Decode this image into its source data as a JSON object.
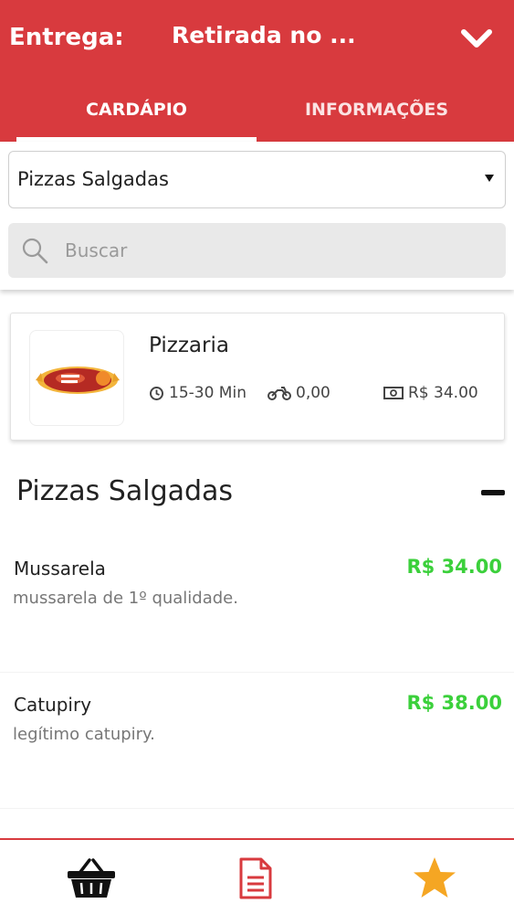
{
  "header": {
    "delivery_label": "Entrega:",
    "delivery_value": "Retirada no ...",
    "background_color": "#d83a3e",
    "tabs": [
      {
        "label": "CARDÁPIO",
        "active": true
      },
      {
        "label": "INFORMAÇÕES",
        "active": false
      }
    ]
  },
  "filter": {
    "category_selected": "Pizzas Salgadas",
    "search_placeholder": "Buscar"
  },
  "store": {
    "name": "Pizzaria",
    "time": "15-30 Min",
    "delivery_fee": "0,00",
    "min_order": "R$ 34.00"
  },
  "section": {
    "title": "Pizzas Salgadas"
  },
  "products": [
    {
      "name": "Mussarela",
      "description": "mussarela de 1º qualidade.",
      "price": "R$ 34.00"
    },
    {
      "name": "Catupiry",
      "description": "legítimo catupiry.",
      "price": "R$ 38.00"
    }
  ],
  "bottom_nav": {
    "icons": [
      "basket-icon",
      "order-document-icon",
      "star-icon"
    ],
    "accent_color": "#d83a3e",
    "star_color": "#f5a623"
  },
  "colors": {
    "price_green": "#3bd03b"
  }
}
